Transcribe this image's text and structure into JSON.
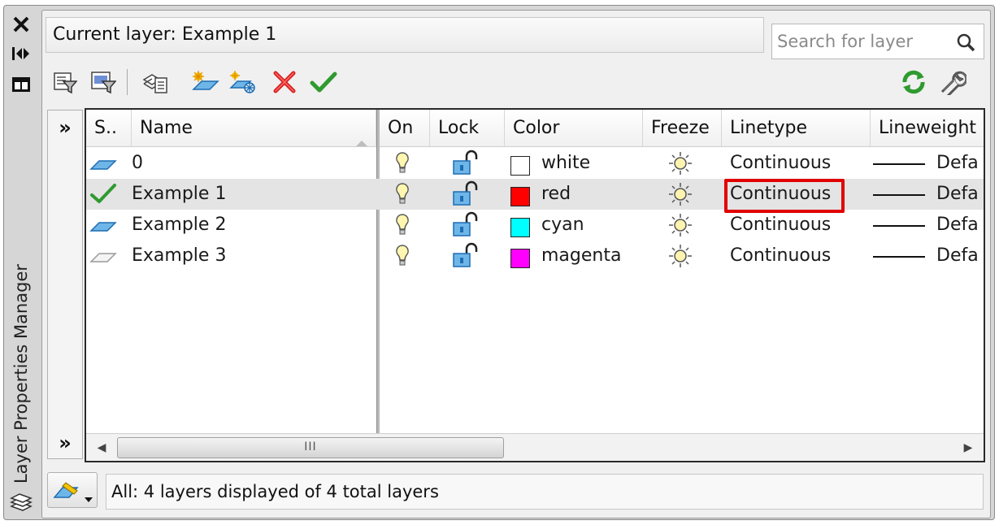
{
  "palette": {
    "title": "Layer Properties Manager",
    "close_glyph": "✕"
  },
  "header": {
    "current_layer": "Current layer: Example 1",
    "search_placeholder": "Search for layer"
  },
  "toolbar": {
    "left_icons": [
      "new-properties-filter-icon",
      "new-group-filter-icon",
      "layer-states-manager-icon",
      "new-layer-icon",
      "new-layer-vp-frozen-icon",
      "delete-layer-icon",
      "set-current-icon"
    ],
    "right_icons": [
      "refresh-icon",
      "settings-icon"
    ]
  },
  "columns": {
    "status": "S..",
    "name": "Name",
    "on": "On",
    "lock": "Lock",
    "color": "Color",
    "freeze": "Freeze",
    "linetype": "Linetype",
    "lineweight": "Lineweight"
  },
  "layers": [
    {
      "status_icon": "layer-icon",
      "name": "0",
      "color_name": "white",
      "color_hex": "#ffffff",
      "linetype": "Continuous",
      "lineweight": "Defa"
    },
    {
      "status_icon": "current-check-icon",
      "name": "Example 1",
      "color_name": "red",
      "color_hex": "#ff0000",
      "linetype": "Continuous",
      "lineweight": "Defa"
    },
    {
      "status_icon": "layer-icon",
      "name": "Example 2",
      "color_name": "cyan",
      "color_hex": "#00ffff",
      "linetype": "Continuous",
      "lineweight": "Defa"
    },
    {
      "status_icon": "layer-unused-icon",
      "name": "Example 3",
      "color_name": "magenta",
      "color_hex": "#ff00ff",
      "linetype": "Continuous",
      "lineweight": "Defa"
    }
  ],
  "scrollbar": {
    "thumb_grip": "III"
  },
  "status": {
    "text": "All: 4 layers displayed of 4 total layers"
  },
  "highlight_color": "#e00000"
}
